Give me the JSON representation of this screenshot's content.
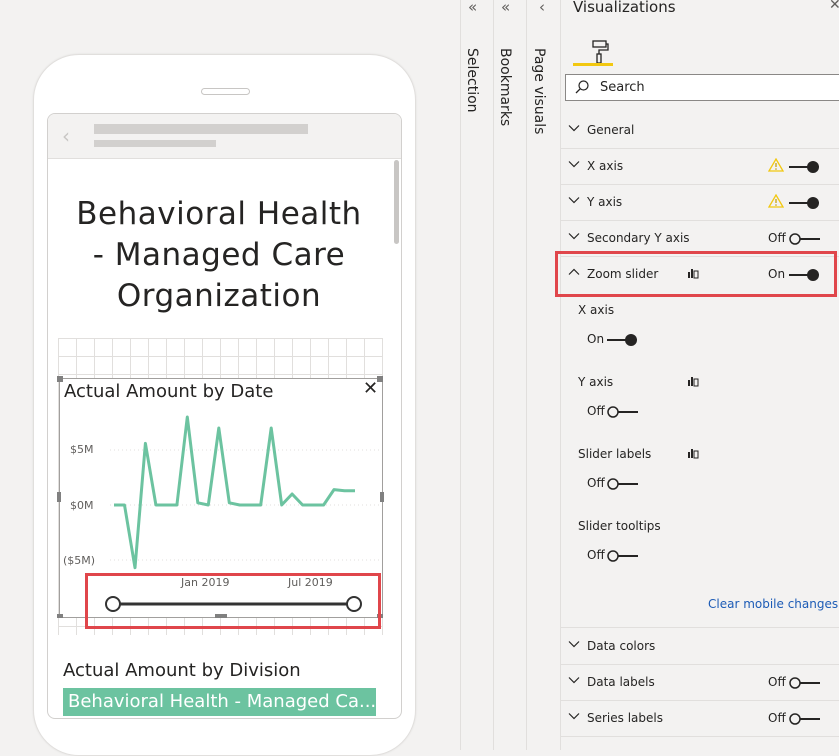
{
  "report": {
    "title_lines": [
      "Behavioral Health",
      "- Managed Care",
      "Organization"
    ]
  },
  "chart": {
    "title": "Actual Amount by Date",
    "y_ticks": [
      "$5M",
      "$0M",
      "($5M)"
    ],
    "x_ticks": [
      "Jan 2019",
      "Jul 2019"
    ],
    "line_color": "#6cc3a0"
  },
  "chart_data": {
    "type": "line",
    "title": "Actual Amount by Date",
    "xlabel": "",
    "ylabel": "",
    "ylim": [
      -6,
      8.5
    ],
    "y_ticks": [
      "$5M",
      "$0M",
      "($5M)"
    ],
    "x_ticks": [
      "Jan 2019",
      "Jul 2019"
    ],
    "x": [
      "2018-07",
      "2018-08",
      "2018-09",
      "2018-10",
      "2018-10b",
      "2018-11",
      "2018-12",
      "2019-01",
      "2019-02",
      "2019-03",
      "2019-04",
      "2019-04b",
      "2019-05",
      "2019-05b",
      "2019-06",
      "2019-06b",
      "2019-07",
      "2019-07b",
      "2019-08",
      "2019-09",
      "2019-10",
      "2019-11",
      "2019-12",
      "2020-01"
    ],
    "series": [
      {
        "values": [
          0,
          0,
          -5.7,
          5.6,
          0,
          0,
          0,
          8.0,
          0.2,
          0,
          7.0,
          0.2,
          0,
          0,
          0,
          7.0,
          0,
          1.0,
          0,
          0,
          0,
          1.4,
          1.3,
          1.3
        ]
      }
    ]
  },
  "slider": {
    "min_pct": 0,
    "max_pct": 100
  },
  "division": {
    "title": "Actual Amount by Division",
    "bar_label": "Behavioral Health - Managed Ca..."
  },
  "panes": {
    "selection": "Selection",
    "bookmarks": "Bookmarks",
    "page_visuals": "Page visuals"
  },
  "viz": {
    "title": "Visualizations",
    "search_placeholder": "Search",
    "sections": {
      "general": "General",
      "x_axis": "X axis",
      "y_axis": "Y axis",
      "secondary_y": "Secondary Y axis",
      "secondary_y_state": "Off",
      "zoom_slider": "Zoom slider",
      "zoom_slider_state": "On",
      "data_colors": "Data colors",
      "data_labels": "Data labels",
      "data_labels_state": "Off",
      "series_labels": "Series labels",
      "series_labels_state": "Off"
    },
    "zoom_sub": {
      "x_axis": "X axis",
      "x_axis_state": "On",
      "y_axis": "Y axis",
      "y_axis_state": "Off",
      "slider_labels": "Slider labels",
      "slider_labels_state": "Off",
      "slider_tooltips": "Slider tooltips",
      "slider_tooltips_state": "Off"
    },
    "clear_mobile": "Clear mobile changes",
    "accent_color": "#f2c811",
    "warning_color": "#f2c811",
    "highlight_color": "#e0464b"
  }
}
